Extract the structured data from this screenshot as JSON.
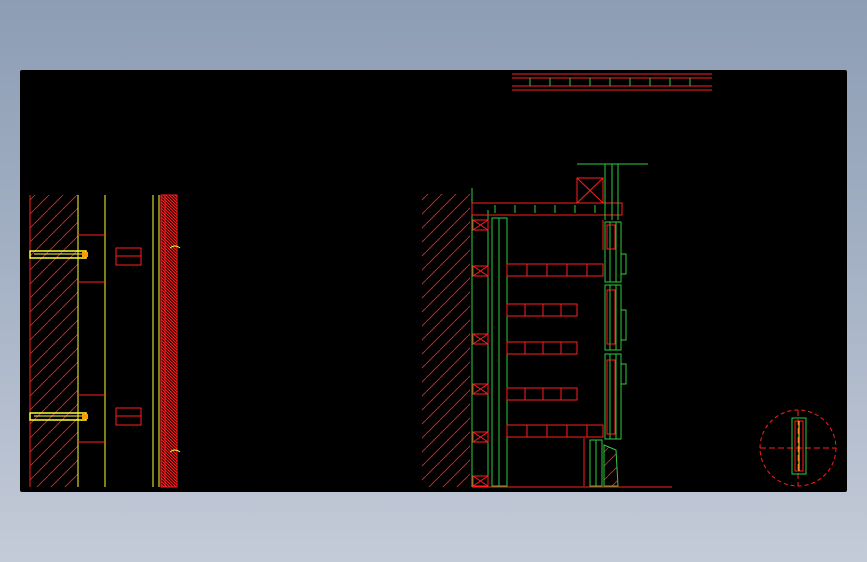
{
  "colors": {
    "background": "#000000",
    "red": "#ff1e1e",
    "green": "#2ecc40",
    "yellow": "#ffff33",
    "desktop_top": "#8d9db4",
    "desktop_bottom": "#c4cbd8"
  },
  "drawing": {
    "views": [
      "elevation-view",
      "section-view",
      "detail-callout"
    ]
  }
}
